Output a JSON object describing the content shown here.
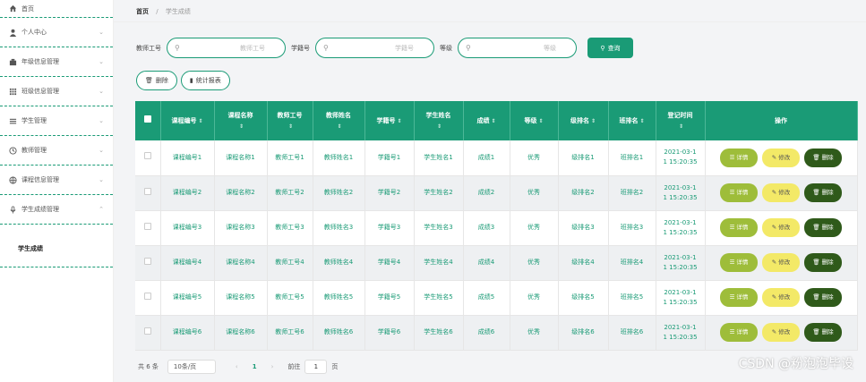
{
  "sidebar": {
    "items": [
      {
        "label": "首页",
        "icon": "home-icon"
      },
      {
        "label": "个人中心",
        "icon": "user-icon"
      },
      {
        "label": "年级信息管理",
        "icon": "building-icon"
      },
      {
        "label": "班级信息管理",
        "icon": "grid-icon"
      },
      {
        "label": "学生管理",
        "icon": "list-icon"
      },
      {
        "label": "教师管理",
        "icon": "clock-icon"
      },
      {
        "label": "课程信息管理",
        "icon": "globe-icon"
      },
      {
        "label": "学生成绩管理",
        "icon": "mic-icon"
      }
    ],
    "sub_item": "学生成绩"
  },
  "breadcrumb": {
    "home": "首页",
    "sep": "/",
    "current": "学生成绩"
  },
  "search": {
    "teacher_label": "教师工号",
    "teacher_placeholder": "教师工号",
    "student_label": "学籍号",
    "student_placeholder": "学籍号",
    "grade_label": "等级",
    "grade_placeholder": "等级",
    "query_button": "查询"
  },
  "actions": {
    "delete": "删除",
    "report": "统计报表"
  },
  "table": {
    "headers": [
      "课程编号",
      "课程名称",
      "教师工号",
      "教师姓名",
      "学籍号",
      "学生姓名",
      "成绩",
      "等级",
      "级排名",
      "班排名",
      "登记时间",
      "操作"
    ],
    "rows": [
      [
        "课程编号1",
        "课程名称1",
        "教师工号1",
        "教师姓名1",
        "学籍号1",
        "学生姓名1",
        "成绩1",
        "优秀",
        "级排名1",
        "班排名1",
        "2021-03-1",
        "1 15:20:35"
      ],
      [
        "课程编号2",
        "课程名称2",
        "教师工号2",
        "教师姓名2",
        "学籍号2",
        "学生姓名2",
        "成绩2",
        "优秀",
        "级排名2",
        "班排名2",
        "2021-03-1",
        "1 15:20:35"
      ],
      [
        "课程编号3",
        "课程名称3",
        "教师工号3",
        "教师姓名3",
        "学籍号3",
        "学生姓名3",
        "成绩3",
        "优秀",
        "级排名3",
        "班排名3",
        "2021-03-1",
        "1 15:20:35"
      ],
      [
        "课程编号4",
        "课程名称4",
        "教师工号4",
        "教师姓名4",
        "学籍号4",
        "学生姓名4",
        "成绩4",
        "优秀",
        "级排名4",
        "班排名4",
        "2021-03-1",
        "1 15:20:35"
      ],
      [
        "课程编号5",
        "课程名称5",
        "教师工号5",
        "教师姓名5",
        "学籍号5",
        "学生姓名5",
        "成绩5",
        "优秀",
        "级排名5",
        "班排名5",
        "2021-03-1",
        "1 15:20:35"
      ],
      [
        "课程编号6",
        "课程名称6",
        "教师工号6",
        "教师姓名6",
        "学籍号6",
        "学生姓名6",
        "成绩6",
        "优秀",
        "级排名6",
        "班排名6",
        "2021-03-1",
        "1 15:20:35"
      ]
    ],
    "op_detail": "详情",
    "op_edit": "修改",
    "op_delete": "删除"
  },
  "pager": {
    "total": "共 6 条",
    "page_size": "10条/页",
    "prev": "‹",
    "current": "1",
    "next": "›",
    "goto": "前往",
    "goto_value": "1",
    "page_unit": "页"
  },
  "watermark": "CSDN @粉泡泡毕设",
  "colors": {
    "accent": "#1a9b76",
    "detail": "#9ebd3a",
    "edit": "#f3e967",
    "delete": "#2f5a1a"
  }
}
